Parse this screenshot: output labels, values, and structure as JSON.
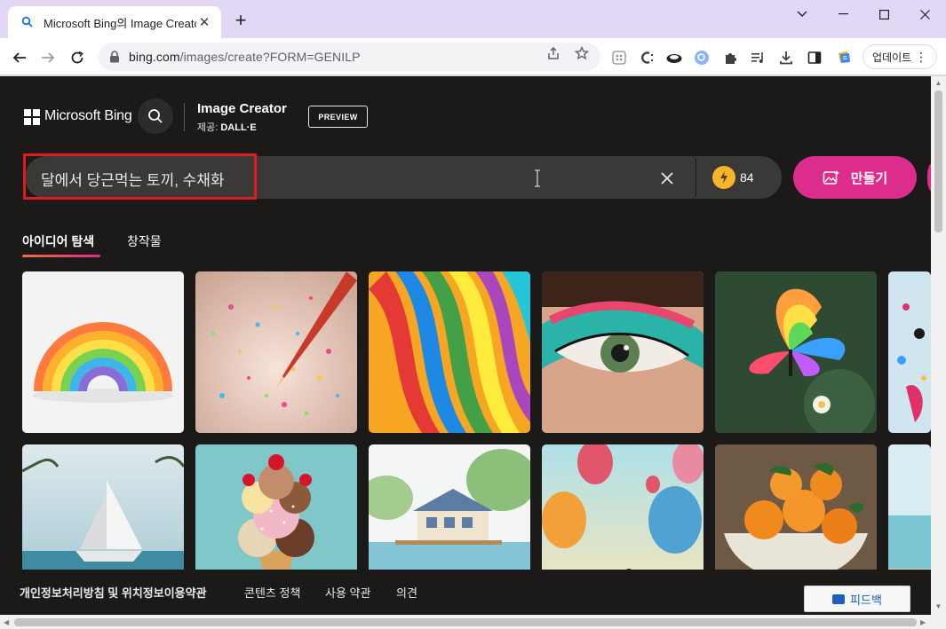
{
  "browser": {
    "tab_title": "Microsoft Bing의 Image Creator",
    "url_domain": "bing.com",
    "url_path": "/images/create?FORM=GENILP",
    "update_label": "업데이트"
  },
  "header": {
    "brand": "Microsoft Bing",
    "title": "Image Creator",
    "subtitle_prefix": "제공:",
    "subtitle_model": "DALL·E",
    "badge": "PREVIEW"
  },
  "prompt": {
    "value": "달에서 당근먹는 토끼, 수채화",
    "boosts": "84",
    "create_label": "만들기"
  },
  "tabs": [
    {
      "label": "아이디어 탐색",
      "active": true
    },
    {
      "label": "창작물",
      "active": false
    }
  ],
  "gallery": [
    {
      "name": "paper-rainbow"
    },
    {
      "name": "colored-pencil-sparkles"
    },
    {
      "name": "colorful-ribbons"
    },
    {
      "name": "eye-makeup"
    },
    {
      "name": "rainbow-butterfly"
    },
    {
      "name": "paint-splash"
    },
    {
      "name": "paper-sailboat"
    },
    {
      "name": "ice-cream-cone"
    },
    {
      "name": "lake-house-watercolor"
    },
    {
      "name": "hot-air-balloons"
    },
    {
      "name": "orange-bowl"
    },
    {
      "name": "beach"
    }
  ],
  "footer": {
    "links": [
      "개인정보처리방침 및 위치정보이용약관",
      "콘텐츠 정책",
      "사용 약관",
      "의견"
    ],
    "feedback_label": "피드백"
  },
  "colors": {
    "page_bg": "#1b1a19",
    "accent_pink": "#dc2c8c",
    "tab_underline_start": "#f06c3b",
    "highlight_red": "#e11a1a",
    "boost_yellow": "#f6b52d"
  }
}
